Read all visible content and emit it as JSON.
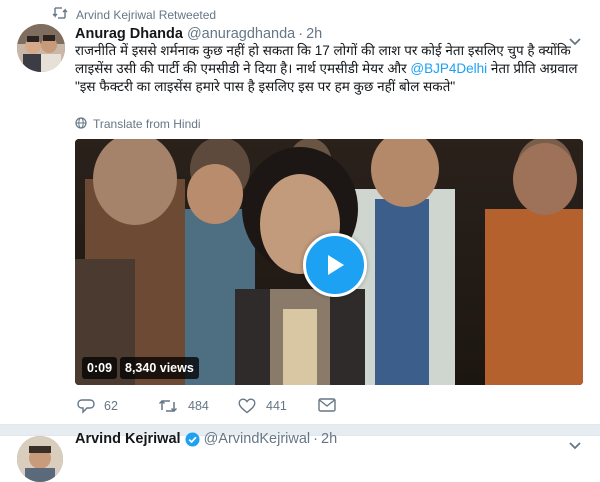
{
  "retweet_header": {
    "text": "Arvind Kejriwal Retweeted",
    "icon": "retweet-icon"
  },
  "tweet": {
    "name": "Anurag Dhanda",
    "handle": "@anuragdhanda",
    "separator": "·",
    "time": "2h",
    "text_part1": "राजनीति में इससे शर्मनाक कुछ नहीं हो सकता कि 17 लोगों की लाश पर कोई नेता इसलिए चुप है क्योंकि लाइसेंस उसी की पार्टी की एमसीडी ने दिया है। नार्थ एमसीडी मेयर और ",
    "mention": "@BJP4Delhi",
    "text_part2": " नेता प्रीति अग्रवाल \"इस फैक्टरी का लाइसेंस हमारे पास है इसलिए इस पर हम कुछ नहीं बोल सकते\"",
    "translate_label": "Translate from Hindi",
    "video": {
      "duration": "0:09",
      "views": "8,340 views"
    },
    "actions": {
      "replies": "62",
      "retweets": "484",
      "likes": "441"
    }
  },
  "next_tweet": {
    "name": "Arvind Kejriwal",
    "handle": "@ArvindKejriwal",
    "separator": "·",
    "time": "2h"
  },
  "colors": {
    "accent": "#1da1f2",
    "muted": "#657786",
    "text": "#14171a",
    "divider": "#e6ecf0"
  }
}
